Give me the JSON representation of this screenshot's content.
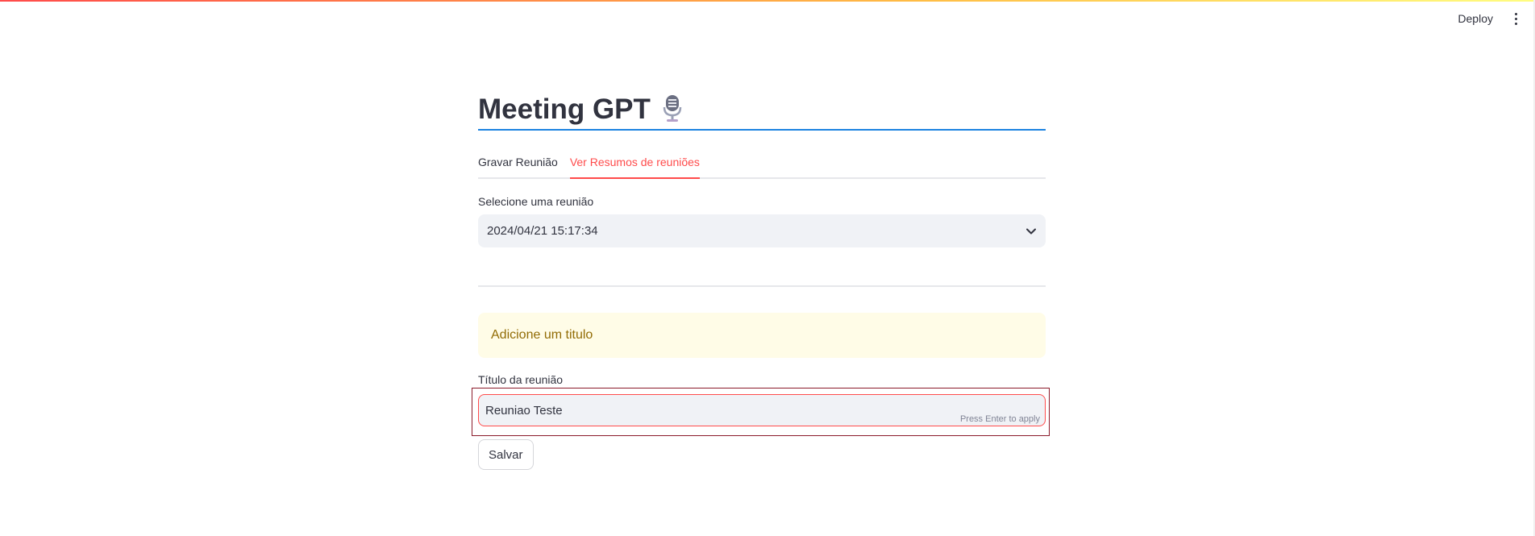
{
  "header": {
    "deploy_label": "Deploy",
    "menu_icon": "kebab-menu-icon"
  },
  "main": {
    "title": "Meeting GPT",
    "title_icon": "microphone-icon",
    "tabs": [
      {
        "label": "Gravar Reunião",
        "active": false
      },
      {
        "label": "Ver Resumos de reuniões",
        "active": true
      }
    ],
    "select": {
      "label": "Selecione uma reunião",
      "value": "2024/04/21 15:17:34",
      "icon": "chevron-down-icon"
    },
    "alert": {
      "text": "Adicione um titulo"
    },
    "title_field": {
      "label": "Título da reunião",
      "value": "Reuniao Teste",
      "hint": "Press Enter to apply"
    },
    "save_label": "Salvar"
  },
  "colors": {
    "accent": "#ff4b4b",
    "title_underline": "#1c83e1",
    "warning_bg": "#fffce7",
    "warning_text": "#926c05",
    "input_bg": "#f0f2f6"
  }
}
